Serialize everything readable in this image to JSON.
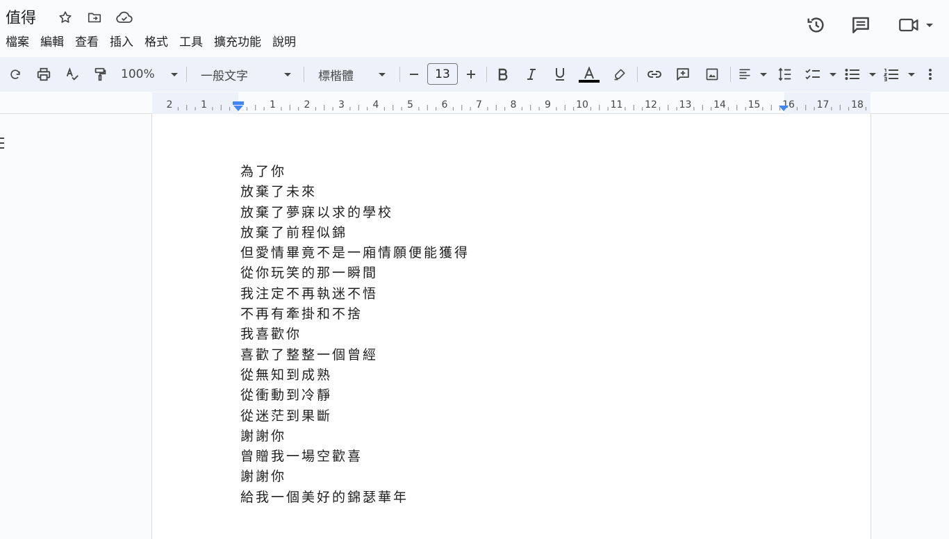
{
  "document": {
    "title": "值得"
  },
  "menu": [
    "檔案",
    "編輯",
    "查看",
    "插入",
    "格式",
    "工具",
    "擴充功能",
    "說明"
  ],
  "toolbar": {
    "zoom": "100%",
    "style": "一般文字",
    "font": "標楷體",
    "font_size": "13",
    "text_color": "#000000"
  },
  "ruler": {
    "left_numbers": [
      "2",
      "1"
    ],
    "right_numbers": [
      "1",
      "2",
      "3",
      "4",
      "5",
      "6",
      "7",
      "8",
      "9",
      "10",
      "11",
      "12",
      "13",
      "14",
      "15",
      "16",
      "17",
      "18"
    ]
  },
  "content": {
    "lines": [
      "為了你",
      "放棄了未來",
      "放棄了夢寐以求的學校",
      "放棄了前程似錦",
      "但愛情畢竟不是一廂情願便能獲得",
      "從你玩笑的那一瞬間",
      "我注定不再執迷不悟",
      "不再有牽掛和不捨",
      "我喜歡你",
      "喜歡了整整一個曾經",
      "從無知到成熟",
      "從衝動到冷靜",
      "從迷茫到果斷",
      "謝謝你",
      "曾贈我一場空歡喜",
      "謝謝你",
      "給我一個美好的錦瑟華年"
    ]
  },
  "colors": {
    "accent": "#4285f4",
    "toolbar_bg": "#edf2fa",
    "page_bg": "#ffffff",
    "app_bg": "#f9fbfd"
  }
}
